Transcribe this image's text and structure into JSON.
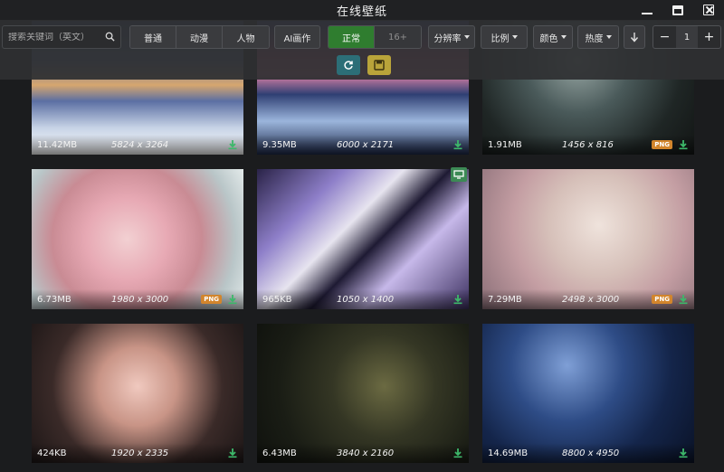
{
  "window": {
    "title": "在线壁纸"
  },
  "toolbar": {
    "search_placeholder": "搜索关键词（英文）",
    "categories": [
      "普通",
      "动漫",
      "人物"
    ],
    "ai_label": "AI画作",
    "purity": [
      "正常",
      "16+"
    ],
    "resolution_label": "分辨率",
    "ratio_label": "比例",
    "color_label": "颜色",
    "sort_label": "热度",
    "page": "1",
    "minus": "−",
    "plus": "+"
  },
  "wallpapers": [
    {
      "size": "11.42MB",
      "resolution": "5824 x 3264",
      "png": ""
    },
    {
      "size": "9.35MB",
      "resolution": "6000 x 2171",
      "png": ""
    },
    {
      "size": "1.91MB",
      "resolution": "1456 x 816",
      "png": "PNG"
    },
    {
      "size": "6.73MB",
      "resolution": "1980 x 3000",
      "png": "PNG"
    },
    {
      "size": "965KB",
      "resolution": "1050 x 1400",
      "png": ""
    },
    {
      "size": "7.29MB",
      "resolution": "2498 x 3000",
      "png": "PNG"
    },
    {
      "size": "424KB",
      "resolution": "1920 x 2335",
      "png": ""
    },
    {
      "size": "6.43MB",
      "resolution": "3840 x 2160",
      "png": ""
    },
    {
      "size": "14.69MB",
      "resolution": "8800 x 4950",
      "png": ""
    }
  ],
  "colors": {
    "accent_green": "#2f7d2f",
    "refresh": "#2c6e77",
    "save": "#b9a43a",
    "png_badge": "#d2852c",
    "download_icon": "#3db86a"
  }
}
